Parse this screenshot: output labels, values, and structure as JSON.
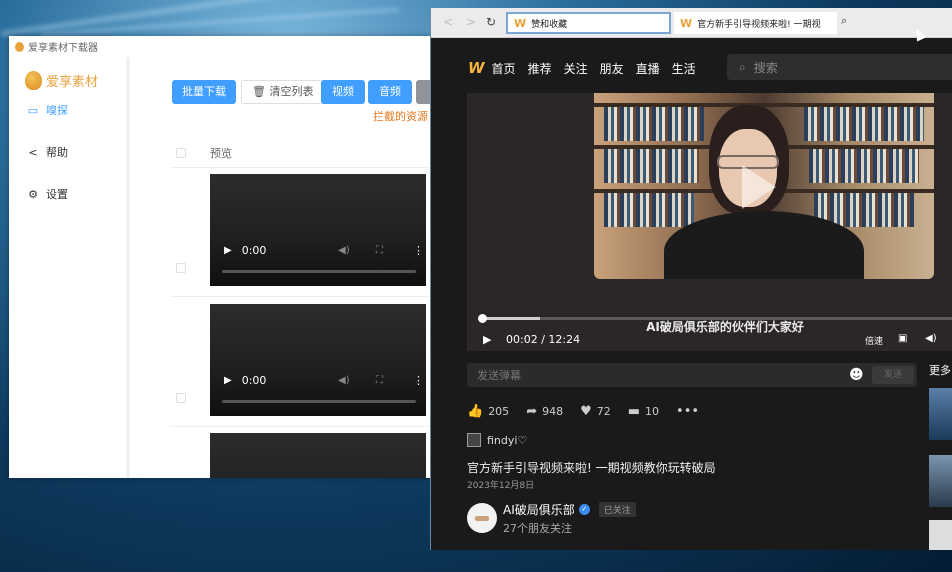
{
  "downloader": {
    "window_title": "爱享素材下载器",
    "brand": "爱享素材",
    "nav": [
      {
        "label": "嗅探",
        "icon": "video-camera-icon"
      },
      {
        "label": "帮助",
        "icon": "share-icon"
      },
      {
        "label": "设置",
        "icon": "gear-icon"
      }
    ],
    "toolbar": {
      "batch_download": "批量下载",
      "clear_list": "清空列表",
      "video": "视频",
      "audio": "音频"
    },
    "warning": "拦截的资源",
    "table": {
      "col_preview": "预览",
      "rows": [
        {
          "time": "0:00"
        },
        {
          "time": "0:00"
        },
        {
          "time": ""
        }
      ]
    }
  },
  "browser": {
    "tabs": [
      {
        "title": "赞和收藏"
      },
      {
        "title": "官方新手引导视频来啦! 一期视"
      }
    ],
    "site_nav": {
      "links": [
        "首页",
        "推荐",
        "关注",
        "朋友",
        "直播",
        "生活"
      ],
      "search_placeholder": "搜索"
    },
    "player": {
      "subtitle": "AI破局俱乐部的伙伴们大家好",
      "time": "00:02 / 12:24",
      "speed_label": "倍速",
      "progress_fraction": 0.0027
    },
    "danmu": {
      "placeholder": "发送弹幕",
      "send": "发送"
    },
    "more_label": "更多",
    "stats": {
      "likes": "205",
      "shares": "948",
      "favorites": "72",
      "comments": "10"
    },
    "author_small": "findyi♡",
    "video_title": "官方新手引导视频来啦! 一期视频教你玩转破局",
    "video_date": "2023年12月8日",
    "channel": {
      "name": "AI破局俱乐部",
      "follow_state": "已关注",
      "friends_following": "27个朋友关注"
    }
  },
  "colors": {
    "accent_blue": "#409eff",
    "brand_orange": "#e6a23c",
    "like_red": "#f0501e"
  }
}
